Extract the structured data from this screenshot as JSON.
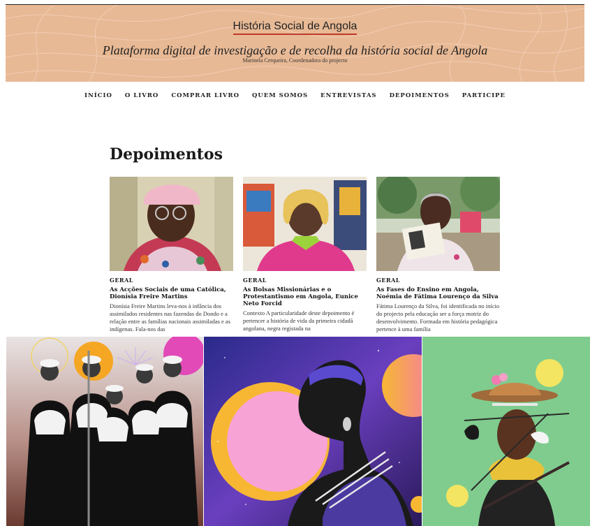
{
  "header": {
    "site_title": "História Social de Angola",
    "tagline": "Plataforma digital de investigação e de recolha da história social de Angola",
    "coordinator": "Marinela Cerqueira, Coordenadora do projecto"
  },
  "nav": {
    "items": [
      "INÍCIO",
      "O LIVRO",
      "COMPRAR LIVRO",
      "QUEM SOMOS",
      "ENTREVISTAS",
      "DEPOIMENTOS",
      "PARTICIPE"
    ]
  },
  "page": {
    "title": "Depoimentos"
  },
  "cards": [
    {
      "category": "GERAL",
      "title": "As Acções Sociais de uma Católica, Dionísia Freire Martins",
      "excerpt": "Dionísia Freire Martins leva-nos à infância dos assimilados residentes nas fazendas do Dondo e a relação entre as famílias nacionais assimiladas e as indígenas. Fala-nos das"
    },
    {
      "category": "GERAL",
      "title": "As Bolsas Missionárias e o Protestantismo em Angola, Eunice Neto Forcid",
      "excerpt": "Contexto A particularidade deste depoimento é pertencer a história de vida da primeira cidadã angolana, negra registada na"
    },
    {
      "category": "GERAL",
      "title": "As Fases do Ensino em Angola, Noémia de Fátima Lourenço da Silva",
      "excerpt": "Fátima Lourenço da Silva, foi identificada no início do projecto pela educação ser a força motriz do desenvolvimento. Formada em história pedagógica pertence à uma família"
    }
  ],
  "colors": {
    "header_bg": "#e8b995",
    "title_underline": "#c0392b",
    "gallery_green": "#7fcc8e"
  }
}
